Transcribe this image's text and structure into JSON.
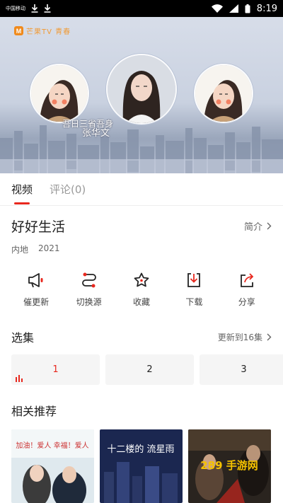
{
  "status_bar": {
    "carrier": "中国移动",
    "time": "8:19",
    "colors": {
      "background": "#000000",
      "foreground": "#ffffff"
    }
  },
  "video": {
    "logo_text": "芒果TV 青春",
    "caption_line1": "吾日三省吾身",
    "caption_line2": "张华文"
  },
  "tabs": [
    {
      "label": "视频",
      "active": true
    },
    {
      "label": "评论(0)",
      "active": false
    }
  ],
  "show": {
    "title": "好好生活",
    "intro_label": "简介",
    "region": "内地",
    "year": "2021"
  },
  "actions": [
    {
      "label": "催更新",
      "icon": "megaphone-icon"
    },
    {
      "label": "切换源",
      "icon": "switch-source-icon"
    },
    {
      "label": "收藏",
      "icon": "star-icon"
    },
    {
      "label": "下载",
      "icon": "download-icon"
    },
    {
      "label": "分享",
      "icon": "share-icon"
    }
  ],
  "episodes_section": {
    "title": "选集",
    "update_text": "更新到16集",
    "episodes": [
      "1",
      "2",
      "3"
    ],
    "active_episode": "1"
  },
  "recommend_section": {
    "title": "相关推荐",
    "posters": [
      {
        "overlay_text": "加油！爱人 幸福！爱人"
      },
      {
        "overlay_text": "十二楼的 流星雨"
      },
      {
        "overlay_text": "289 手游网"
      }
    ]
  },
  "colors": {
    "accent": "#e8281e",
    "episode_bg": "#f5f5f5",
    "muted_text": "#999999"
  }
}
